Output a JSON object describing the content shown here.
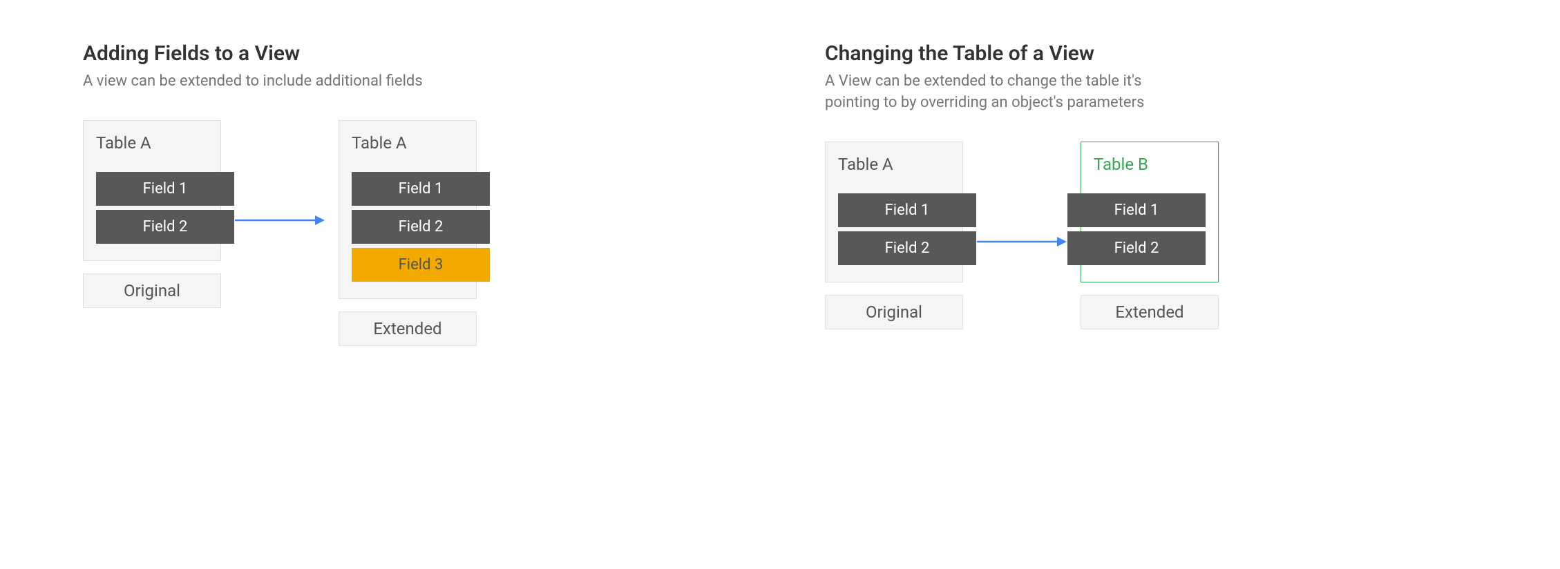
{
  "left": {
    "heading": "Adding Fields to a View",
    "subheading": "A view can be extended to include additional fields",
    "original": {
      "table": "Table A",
      "fields": [
        "Field 1",
        "Field 2"
      ],
      "label": "Original"
    },
    "extended": {
      "table": "Table A",
      "fields": [
        "Field 1",
        "Field 2",
        "Field 3"
      ],
      "label": "Extended"
    }
  },
  "right": {
    "heading": "Changing the Table of a View",
    "subheading": "A View can be extended to change the table it's pointing to by overriding an object's parameters",
    "original": {
      "table": "Table A",
      "fields": [
        "Field 1",
        "Field 2"
      ],
      "label": "Original"
    },
    "extended": {
      "table": "Table B",
      "fields": [
        "Field 1",
        "Field 2"
      ],
      "label": "Extended"
    }
  },
  "colors": {
    "field": "#585858",
    "highlight": "#f2a900",
    "arrow": "#4285f4",
    "green": "#34a853"
  }
}
